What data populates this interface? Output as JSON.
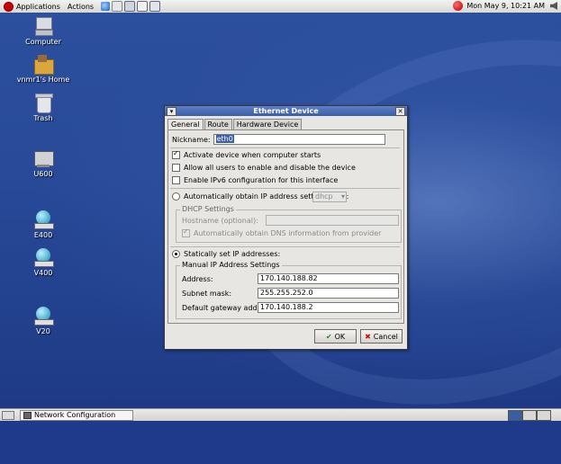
{
  "top_panel": {
    "menus": [
      "Applications",
      "Actions"
    ],
    "clock": "Mon May  9, 10:21 AM"
  },
  "desktop_icons": [
    {
      "label": "Computer",
      "icon": "computer-icon"
    },
    {
      "label": "vnmr1's Home",
      "icon": "home-folder-icon"
    },
    {
      "label": "Trash",
      "icon": "trash-icon"
    },
    {
      "label": "U600",
      "icon": "server-icon"
    },
    {
      "label": "E400",
      "icon": "network-host-icon"
    },
    {
      "label": "V400",
      "icon": "network-host-icon"
    },
    {
      "label": "V20",
      "icon": "network-host-icon"
    }
  ],
  "dialog": {
    "title": "Ethernet Device",
    "tabs": [
      "General",
      "Route",
      "Hardware Device"
    ],
    "nickname_label": "Nickname:",
    "nickname_value": "eth0",
    "activate_label": "Activate device when computer starts",
    "allow_users_label": "Allow all users to enable and disable the device",
    "ipv6_label": "Enable IPv6 configuration for this interface",
    "auto_label": "Automatically obtain IP address settings with:",
    "auto_method": "dhcp",
    "dhcp_title": "DHCP Settings",
    "hostname_label": "Hostname (optional):",
    "auto_dns_label": "Automatically obtain DNS information from provider",
    "static_label": "Statically set IP addresses:",
    "manual_title": "Manual IP Address Settings",
    "address_label": "Address:",
    "address_value": "170.140.188.82",
    "subnet_label": "Subnet mask:",
    "subnet_value": "255.255.252.0",
    "gateway_label": "Default gateway address:",
    "gateway_value": "170.140.188.2",
    "ok_label": "OK",
    "cancel_label": "Cancel"
  },
  "taskbar": {
    "task_label": "Network Configuration"
  }
}
